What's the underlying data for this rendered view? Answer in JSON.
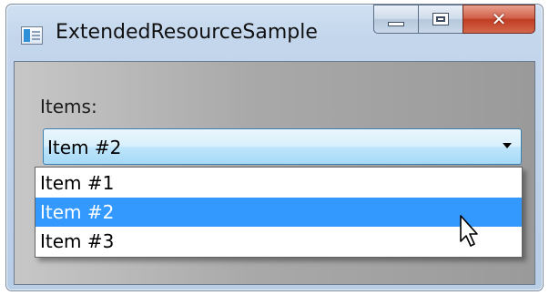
{
  "window": {
    "title": "ExtendedResourceSample",
    "icon": "app-window-icon",
    "caption_buttons": [
      "minimize",
      "maximize",
      "close"
    ]
  },
  "form": {
    "items_label": "Items:",
    "combo": {
      "selected_value": "Item #2",
      "arrow_icon": "dropdown-arrow-icon"
    },
    "options": [
      "Item #1",
      "Item #2",
      "Item #3"
    ],
    "highlighted_option": "Item #2"
  },
  "colors": {
    "selection": "#3399ff",
    "close_button": "#c13d24",
    "combo_border": "#3c7fb1"
  }
}
